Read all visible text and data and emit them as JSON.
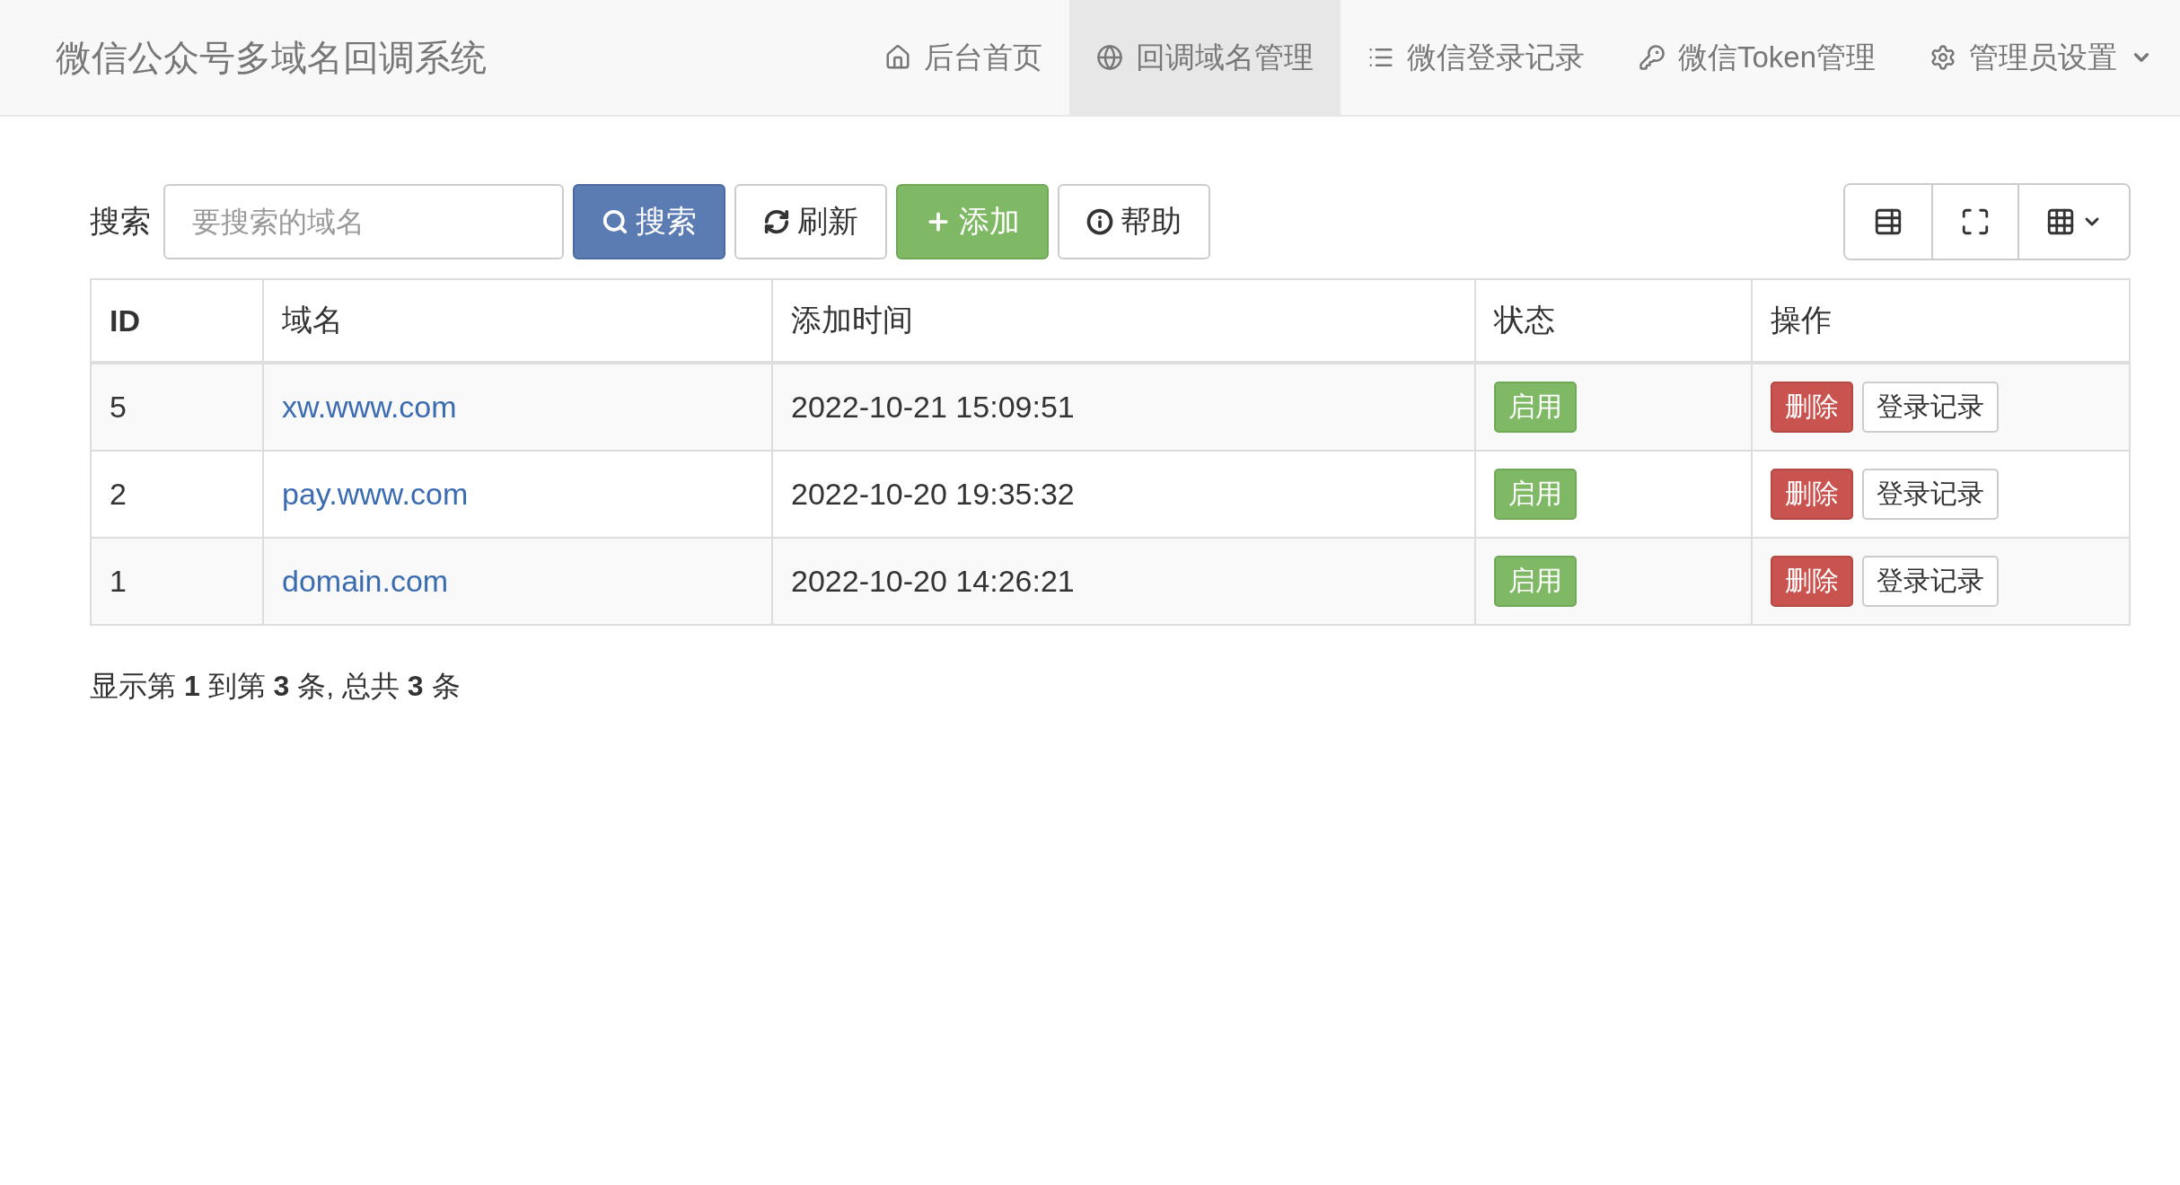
{
  "navbar": {
    "brand": "微信公众号多域名回调系统",
    "items": [
      {
        "label": "后台首页",
        "selected": false,
        "dropdown": false
      },
      {
        "label": "回调域名管理",
        "selected": true,
        "dropdown": false
      },
      {
        "label": "微信登录记录",
        "selected": false,
        "dropdown": false
      },
      {
        "label": "微信Token管理",
        "selected": false,
        "dropdown": false
      },
      {
        "label": "管理员设置",
        "selected": false,
        "dropdown": true
      }
    ]
  },
  "toolbar": {
    "search_label": "搜索",
    "search_placeholder": "要搜索的域名",
    "buttons": [
      {
        "label": "搜索",
        "kind": "primary"
      },
      {
        "label": "刷新",
        "kind": "default"
      },
      {
        "label": "添加",
        "kind": "success"
      },
      {
        "label": "帮助",
        "kind": "default"
      }
    ]
  },
  "table": {
    "columns": [
      "ID",
      "域名",
      "添加时间",
      "状态",
      "操作"
    ],
    "rows": [
      {
        "id": "5",
        "domain": "xw.www.com",
        "time": "2022-10-21 15:09:51",
        "status": "启用",
        "actions": [
          "删除",
          "登录记录"
        ]
      },
      {
        "id": "2",
        "domain": "pay.www.com",
        "time": "2022-10-20 19:35:32",
        "status": "启用",
        "actions": [
          "删除",
          "登录记录"
        ]
      },
      {
        "id": "1",
        "domain": "domain.com",
        "time": "2022-10-20 14:26:21",
        "status": "启用",
        "actions": [
          "删除",
          "登录记录"
        ]
      }
    ]
  },
  "pagination_info": "显示第 **1** 到第 **3** 条, 总共 **3** 条"
}
